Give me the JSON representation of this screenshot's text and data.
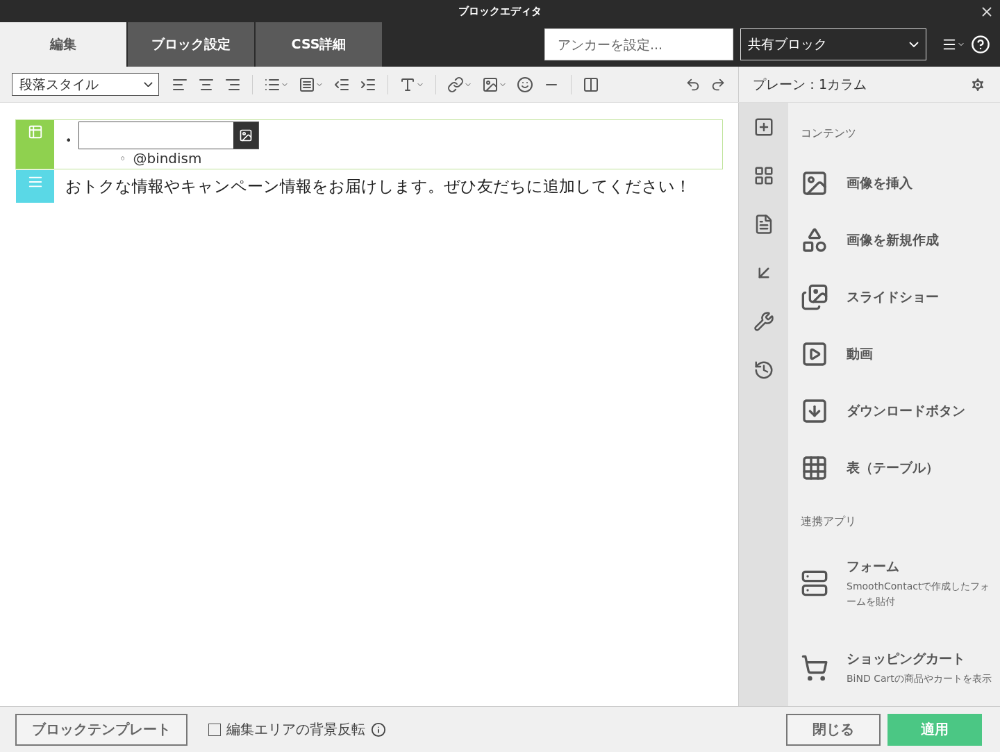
{
  "window": {
    "title": "ブロックエディタ"
  },
  "tabs": [
    {
      "label": "編集",
      "selected": true
    },
    {
      "label": "ブロック設定",
      "selected": false
    },
    {
      "label": "CSS詳細",
      "selected": false
    }
  ],
  "anchor_field": {
    "placeholder": "アンカーを設定..."
  },
  "block_type_select": {
    "value": "共有ブロック"
  },
  "toolbar": {
    "paragraph_style": "段落スタイル"
  },
  "layout_panel": {
    "title": "プレーン：1カラム"
  },
  "blocks": [
    {
      "kind": "list",
      "color": "#8fd14f",
      "selected": true,
      "items": [
        {
          "marker": "•",
          "children": [
            {
              "marker": "◦",
              "text": "@bindism"
            }
          ]
        }
      ]
    },
    {
      "kind": "paragraph",
      "color": "#5ad8e6",
      "selected": false,
      "text": "おトクな情報やキャンペーン情報をお届けします。ぜひ友だちに追加してください！"
    }
  ],
  "sidebar": {
    "sections": [
      {
        "title": "コンテンツ",
        "items": [
          {
            "label": "画像を挿入"
          },
          {
            "label": "画像を新規作成"
          },
          {
            "label": "スライドショー"
          },
          {
            "label": "動画"
          },
          {
            "label": "ダウンロードボタン"
          },
          {
            "label": "表（テーブル）"
          }
        ]
      },
      {
        "title": "連携アプリ",
        "items": [
          {
            "label": "フォーム",
            "description": "SmoothContactで作成したフォームを貼付"
          },
          {
            "label": "ショッピングカート",
            "description": "BiND Cartの商品やカートを表示"
          }
        ]
      }
    ]
  },
  "footer": {
    "template_button": "ブロックテンプレート",
    "invert_checkbox": {
      "label": "編集エリアの背景反転",
      "checked": false
    },
    "buttons": [
      {
        "label": "閉じる",
        "kind": "secondary"
      },
      {
        "label": "適用",
        "kind": "primary"
      }
    ]
  }
}
